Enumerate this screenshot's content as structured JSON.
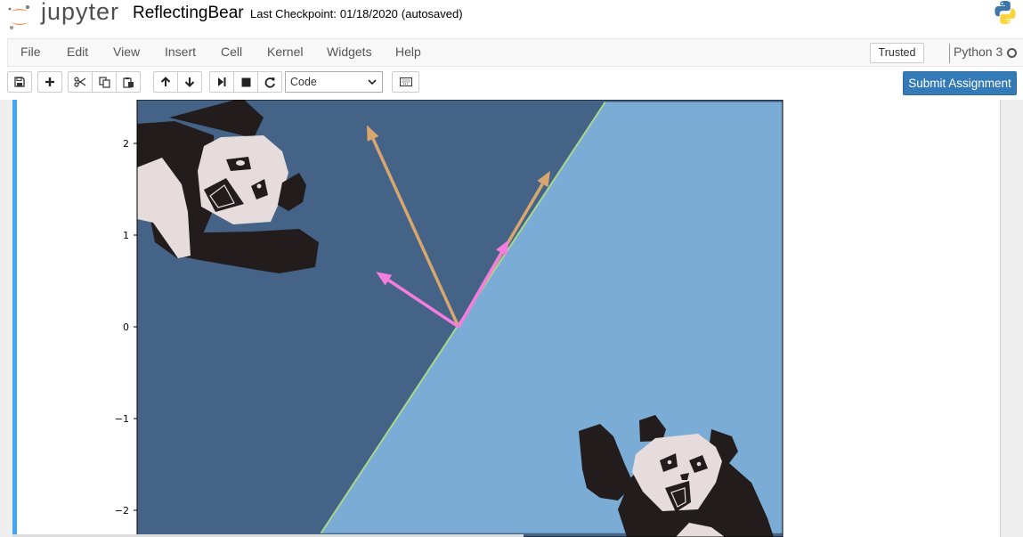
{
  "header": {
    "logo_text": "jupyter",
    "notebook_name": "ReflectingBear",
    "checkpoint_label": "Last Checkpoint:",
    "checkpoint_time": "01/18/2020",
    "autosave_status": "(autosaved)",
    "python_logo_icon": "python-logo-icon"
  },
  "menubar": {
    "items": [
      "File",
      "Edit",
      "View",
      "Insert",
      "Cell",
      "Kernel",
      "Widgets",
      "Help"
    ],
    "trusted_label": "Trusted",
    "kernel_name": "Python 3"
  },
  "toolbar": {
    "icons": [
      "save-icon",
      "plus-icon",
      "cut-icon",
      "copy-icon",
      "paste-icon",
      "arrow-up-icon",
      "arrow-down-icon",
      "step-forward-icon",
      "stop-icon",
      "refresh-icon",
      "keyboard-icon"
    ],
    "cell_type_value": "Code",
    "submit_label": "Submit Assignment"
  },
  "plot": {
    "yticks": [
      "2",
      "1",
      "0",
      "−1",
      "−2"
    ],
    "colors": {
      "dark_region": "#456287",
      "light_region": "#7aacd6",
      "mirror_line": "#a6d88f",
      "tan_arrow": "#d8a76e",
      "pink_arrow": "#f47ddd",
      "panda_black": "#221c1c",
      "panda_white": "#e7dcdc"
    }
  },
  "chart_data": {
    "type": "line",
    "title": "",
    "xlabel": "",
    "ylabel": "",
    "ylim": [
      -2.25,
      2.45
    ],
    "yticks": [
      2,
      1,
      0,
      -1,
      -2
    ],
    "series": [
      {
        "label": "mirror",
        "x": [
          -1.5,
          1.6
        ],
        "y": [
          -2.25,
          2.45
        ]
      }
    ],
    "arrows": [
      {
        "label": "tan-original",
        "from": [
          0,
          0
        ],
        "to": [
          -1.0,
          2.2
        ]
      },
      {
        "label": "tan-reflected",
        "from": [
          0,
          0
        ],
        "to": [
          1.0,
          1.7
        ]
      },
      {
        "label": "pink-original",
        "from": [
          0,
          0
        ],
        "to": [
          -0.9,
          0.6
        ]
      },
      {
        "label": "pink-reflected",
        "from": [
          0,
          0
        ],
        "to": [
          0.55,
          0.95
        ]
      }
    ]
  }
}
